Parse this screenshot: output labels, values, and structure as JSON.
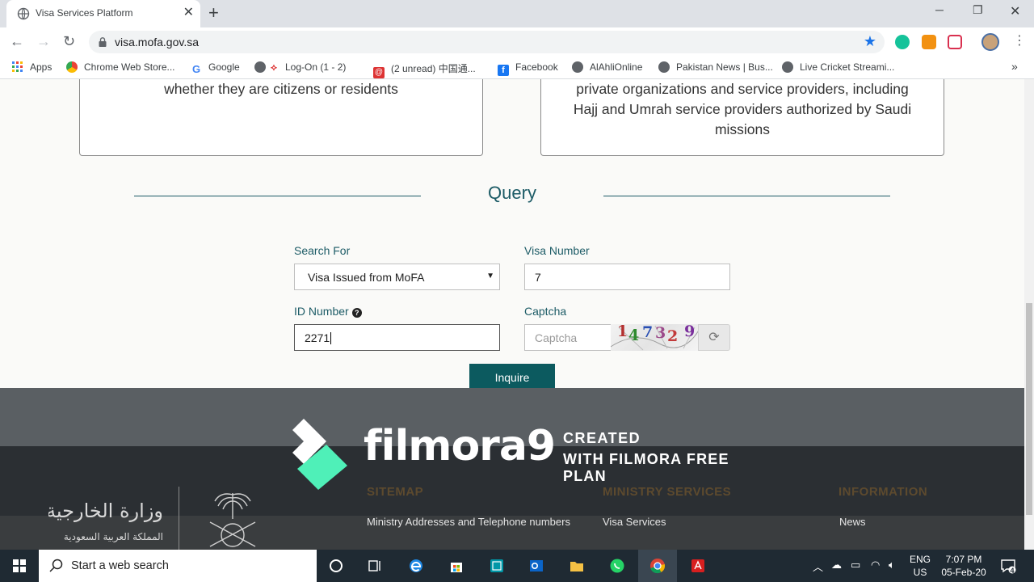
{
  "browser": {
    "tab_title": "Visa Services Platform",
    "url": "visa.mofa.gov.sa",
    "bookmarks": [
      {
        "label": "Apps"
      },
      {
        "label": "Chrome Web Store..."
      },
      {
        "label": "Google"
      },
      {
        "label": "Log-On (1 - 2)"
      },
      {
        "label": "(2 unread) 中国通..."
      },
      {
        "label": "Facebook"
      },
      {
        "label": "AlAhliOnline"
      },
      {
        "label": "Pakistan News | Bus..."
      },
      {
        "label": "Live Cricket Streami..."
      }
    ]
  },
  "cards": {
    "left_text": "whether they are citizens or residents",
    "right_text": "private organizations and service providers, including Hajj and Umrah service providers authorized by Saudi missions"
  },
  "query": {
    "title": "Query",
    "search_for_label": "Search For",
    "search_for_value": "Visa Issued from MoFA",
    "visa_number_label": "Visa Number",
    "visa_number_value": "7",
    "id_number_label": "ID Number",
    "id_number_value": "2271",
    "captcha_label": "Captcha",
    "captcha_placeholder": "Captcha",
    "captcha_chars": [
      "1",
      "4",
      "7",
      "3",
      "2",
      "9"
    ],
    "inquire_label": "Inquire"
  },
  "footer": {
    "sitemap_heading": "SITEMAP",
    "ministry_heading": "MINISTRY SERVICES",
    "information_heading": "INFORMATION",
    "sitemap_link": "Ministry Addresses and Telephone numbers",
    "ministry_link": "Visa Services",
    "information_link": "News",
    "logo_ar_line1": "وزارة الخارجية",
    "logo_ar_line2": "المملكة العربية السعودية"
  },
  "watermark": {
    "word": "filmora9",
    "created": "CREATED",
    "plan": "WITH FILMORA FREE PLAN"
  },
  "taskbar": {
    "search_placeholder": "Start a web search",
    "lang_top": "ENG",
    "lang_bottom": "US",
    "time": "7:07 PM",
    "date": "05-Feb-20",
    "notification_count": "4"
  },
  "colors": {
    "accent": "#1c5b66",
    "button": "#0c5a5f",
    "footer_heading": "#5d4a2e"
  }
}
